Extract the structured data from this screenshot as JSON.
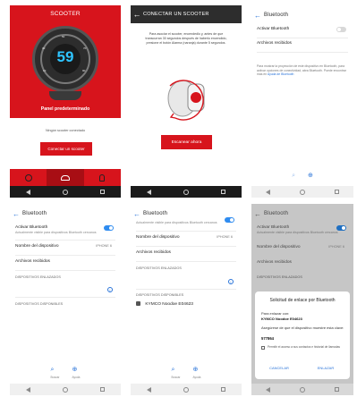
{
  "screen1": {
    "title": "SCOOTER",
    "speed": "59",
    "gauge_ticks": [
      "10",
      "20",
      "30",
      "40",
      "50",
      "60",
      "70",
      "80",
      "90",
      "100"
    ],
    "panel_label": "Panel predeterminado",
    "status_text": "Ningún scooter conectado",
    "connect_button": "Conectar un scooter",
    "icons": [
      "gauge-tab-icon",
      "scooter-tab-icon",
      "user-tab-icon"
    ],
    "accent": "#d7141c"
  },
  "screen2": {
    "title": "CONECTAR UN SCOOTER",
    "instructions": "Para asociar el scooter, encendedlo y, antes de que transcurran 30 segundos después de haberlo encendido, presione el botón Alarma (naranja) durante 5 segundos.",
    "scan_button": "Escanear ahora"
  },
  "screen3": {
    "title": "Bluetooth",
    "activate_label": "Activar Bluetooth",
    "received_files": "Archivos recibidos",
    "help_text": "Para mostrar la proyección de este dispositivo en Bluetooth, para activar opciones de conectividad, abra Bluetooth. Puede encontrar más en",
    "help_link": "Ayuda de Bluetooth"
  },
  "screen4": {
    "title": "Bluetooth",
    "activate_label": "Activar Bluetooth",
    "activate_sub": "Actualmente visible para dispositivos Bluetooth cercanos",
    "device_name_label": "Nombre del dispositivo",
    "device_name_value": "IPHONE 6",
    "received_files": "Archivos recibidos",
    "paired_section": "DISPOSITIVOS ENLAZADOS",
    "available_section": "DISPOSITIVOS DISPONIBLES",
    "bottom_actions": [
      "Buscar",
      "Ayuda"
    ]
  },
  "screen5": {
    "title": "Bluetooth",
    "activate_sub": "Actualmente visible para dispositivos Bluetooth cercanos",
    "device_name_label": "Nombre del dispositivo",
    "device_name_value": "IPHONE 6",
    "received_files": "Archivos recibidos",
    "paired_section": "DISPOSITIVOS ENLAZADOS",
    "available_section": "DISPOSITIVOS DISPONIBLES",
    "device": "KYMCO Noodoe E04623",
    "bottom_actions": [
      "Buscar",
      "Ayuda"
    ]
  },
  "screen6": {
    "title": "Bluetooth",
    "activate_label": "Activar Bluetooth",
    "activate_sub": "Actualmente visible para dispositivos Bluetooth cercanos",
    "device_name_label": "Nombre del dispositivo",
    "device_name_value": "IPHONE 6",
    "received_files": "Archivos recibidos",
    "paired_section": "DISPOSITIVOS ENLAZADOS",
    "dialog": {
      "title": "Solicitud de enlace por Bluetooth",
      "pair_with_label": "Para enlazar con:",
      "pair_with_device": "KYMCO Noodoe E04623",
      "ensure_label": "Asegúrese de que el dispositivo muestre esta clave:",
      "passkey": "577864",
      "checkbox_label": "Permitir el acceso a sus contactos e historial de llamadas",
      "cancel": "CANCELAR",
      "pair": "ENLAZAR"
    }
  }
}
